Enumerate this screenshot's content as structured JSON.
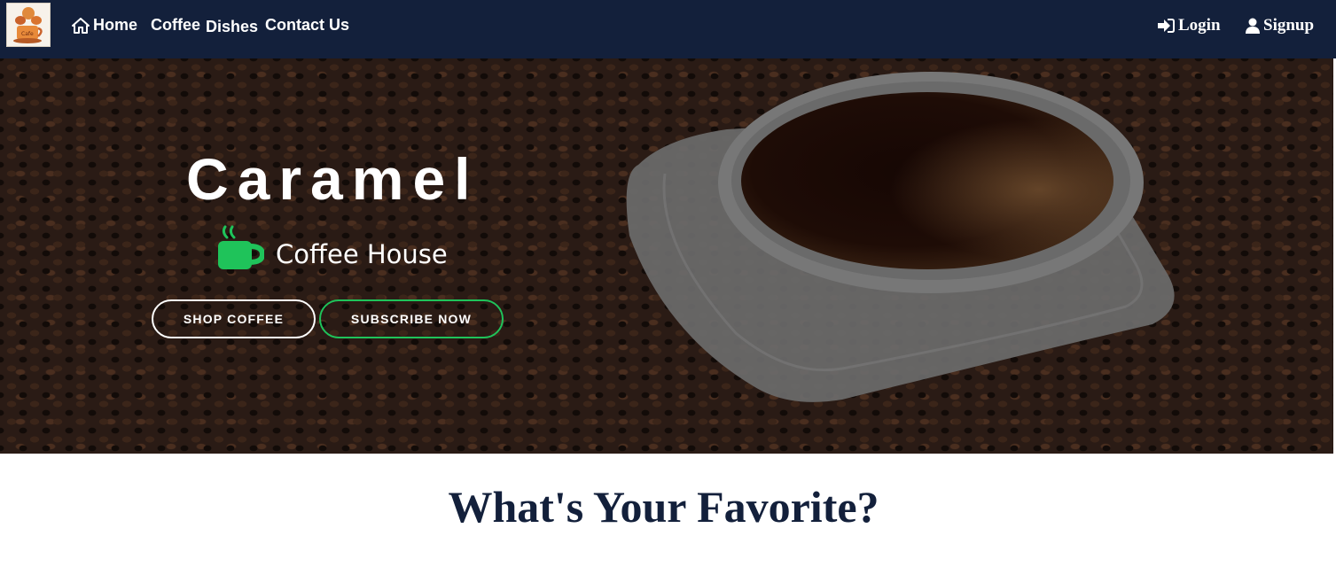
{
  "navbar": {
    "logo_icon": "coffee-house-logo-icon",
    "links": {
      "home": "Home",
      "coffee": "Coffee",
      "dishes": "Dishes",
      "contact": "Contact Us"
    },
    "login": "Login",
    "signup": "Signup",
    "icons": {
      "home": "home-icon",
      "login": "sign-in-icon",
      "signup": "user-icon"
    }
  },
  "hero": {
    "title": "Caramel",
    "subtitle": "Coffee House",
    "subtitle_icon": "coffee-cup-icon",
    "buttons": {
      "shop": "SHOP COFFEE",
      "subscribe": "SUBSCRIBE NOW"
    }
  },
  "section": {
    "title": "What's Your Favorite?"
  },
  "colors": {
    "navbar_bg": "#13203b",
    "accent_green": "#1fc35a",
    "heading": "#13203b"
  }
}
